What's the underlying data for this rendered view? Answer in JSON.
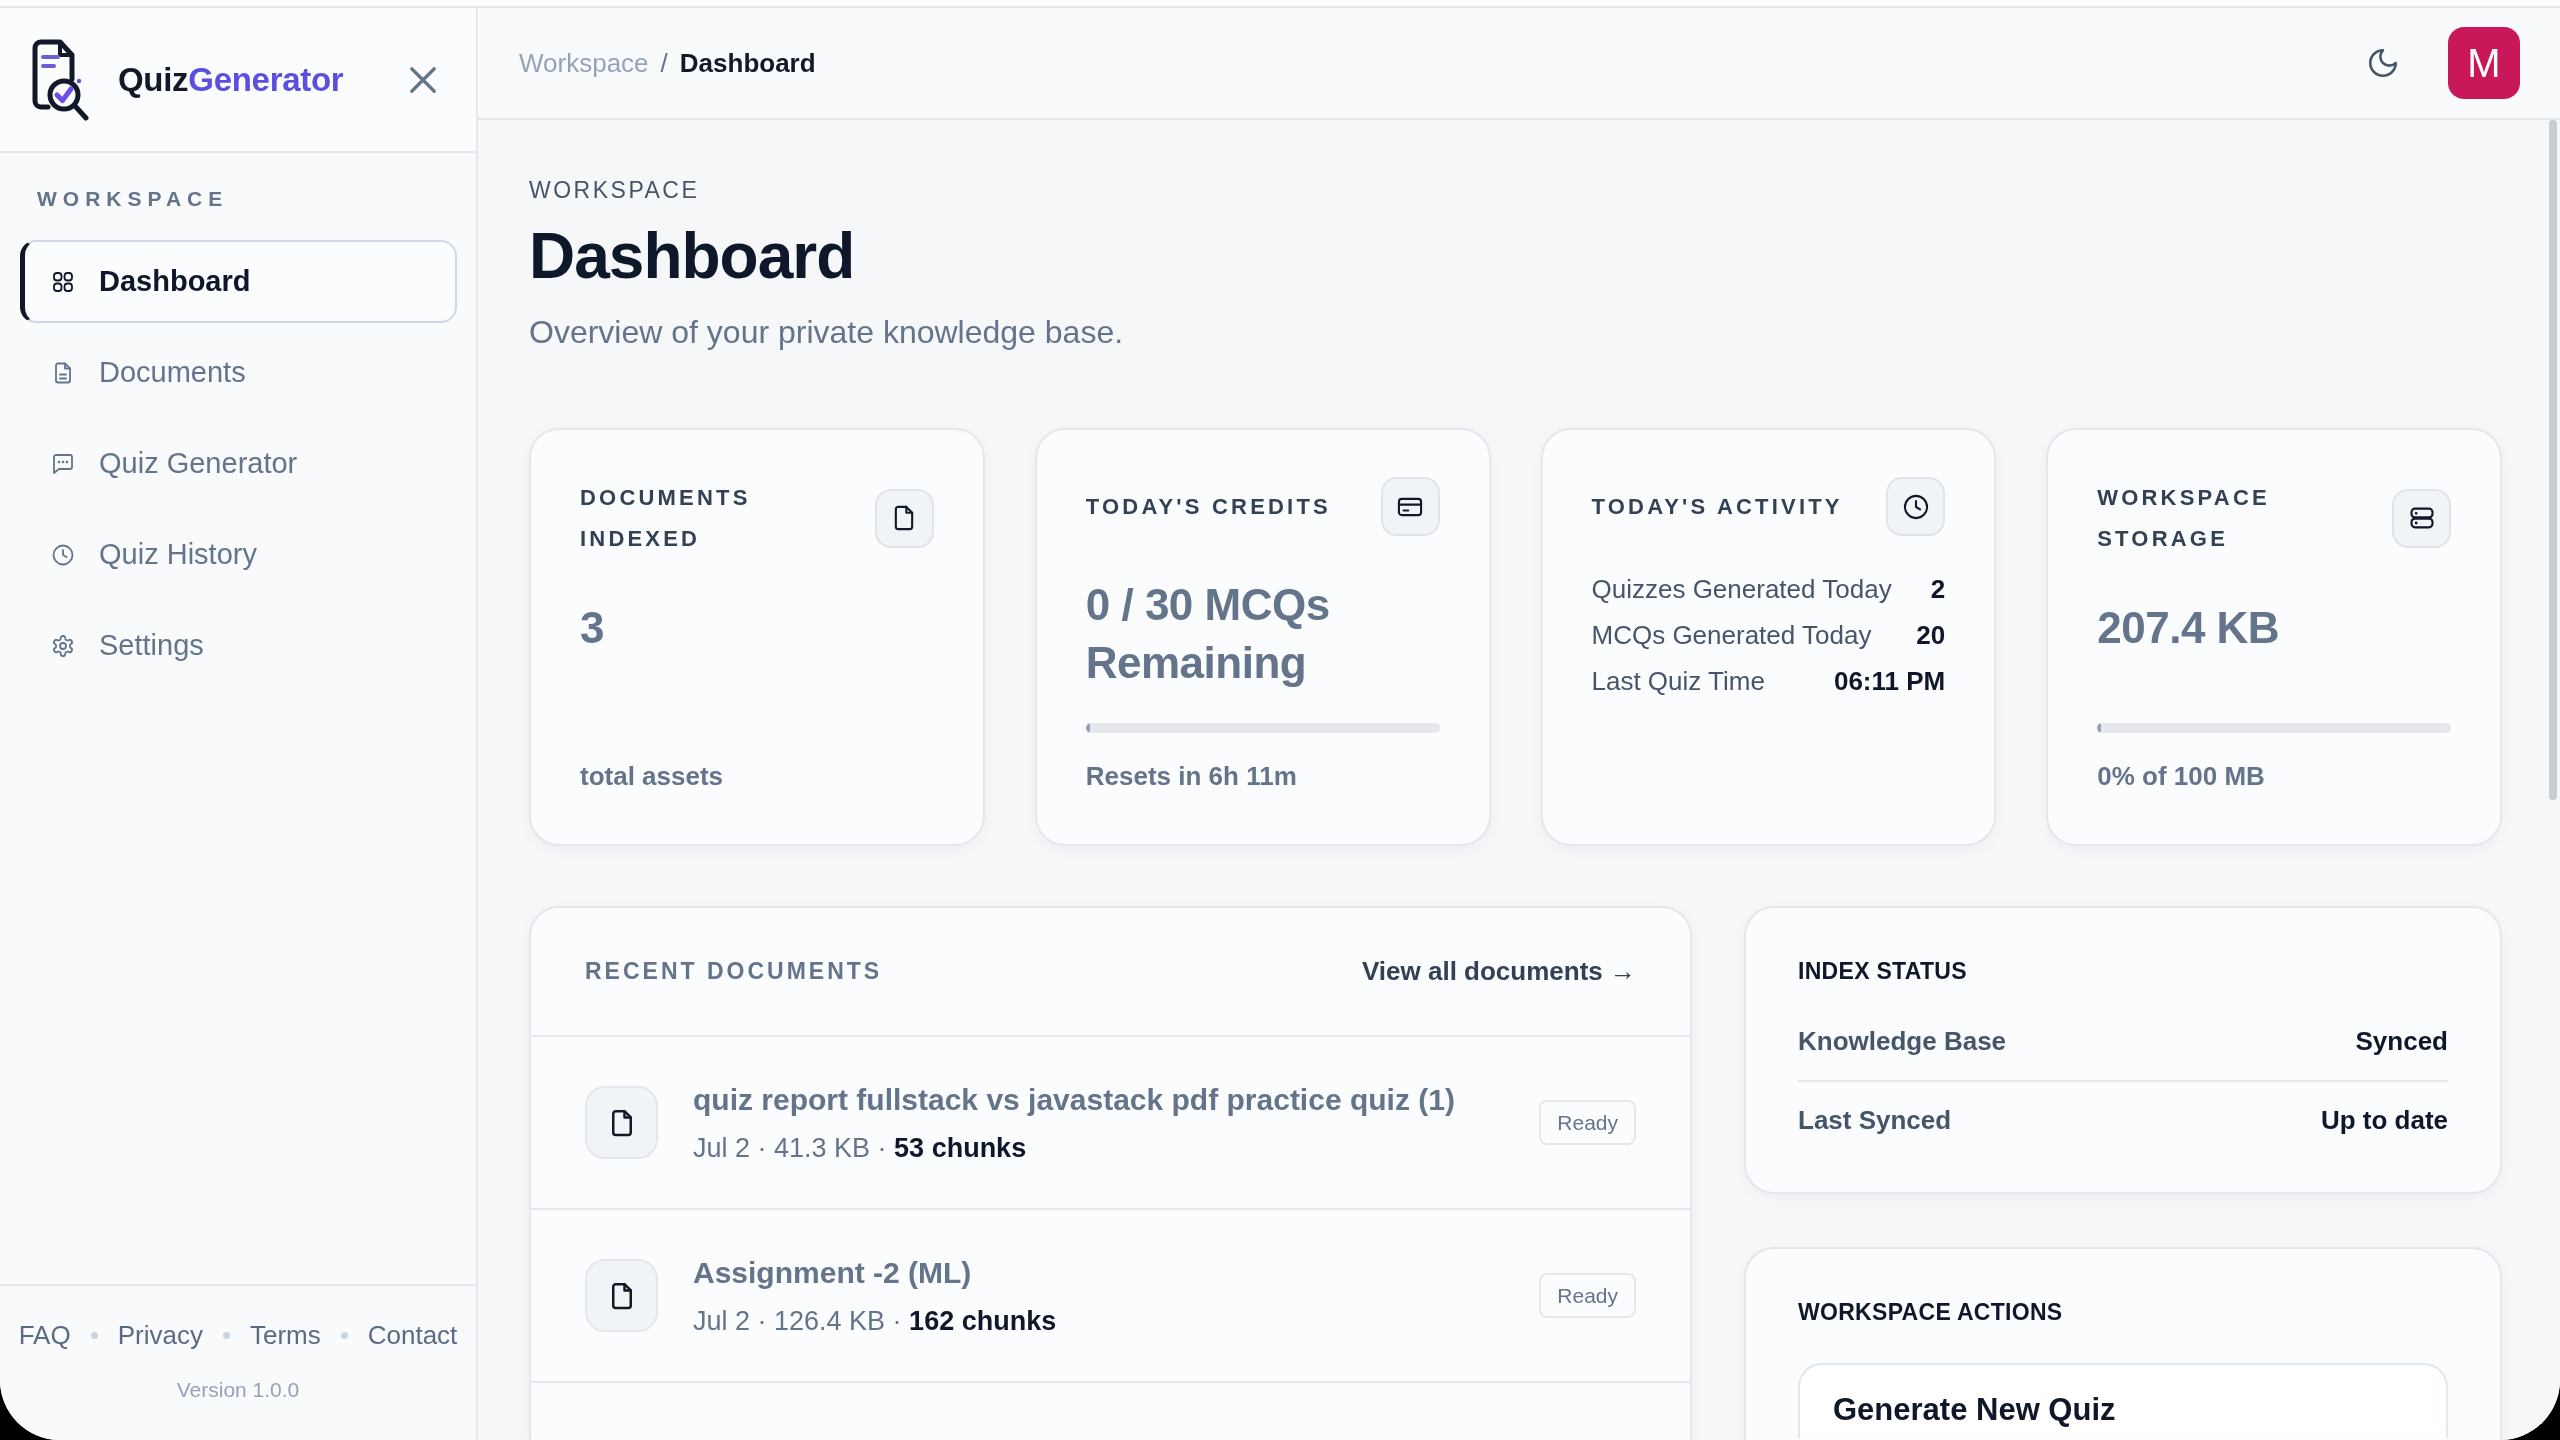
{
  "sidebar": {
    "logo": {
      "name": "Quiz",
      "accent": "Generator"
    },
    "section_label": "WORKSPACE",
    "items": [
      {
        "label": "Dashboard",
        "selected": true
      },
      {
        "label": "Documents",
        "selected": false
      },
      {
        "label": "Quiz Generator",
        "selected": false
      },
      {
        "label": "Quiz History",
        "selected": false
      },
      {
        "label": "Settings",
        "selected": false
      }
    ],
    "footer_links": [
      "FAQ",
      "Privacy",
      "Terms",
      "Contact"
    ],
    "version": "Version 1.0.0"
  },
  "header": {
    "breadcrumb": [
      {
        "label": "Workspace",
        "current": false
      },
      {
        "label": "Dashboard",
        "current": true
      }
    ],
    "separator": "/",
    "avatar": "M"
  },
  "page": {
    "eyebrow": "WORKSPACE",
    "title": "Dashboard",
    "subtitle": "Overview of your private knowledge base."
  },
  "stats": [
    {
      "kind": "value",
      "label": "DOCUMENTS INDEXED",
      "value": "3",
      "footer": "total assets"
    },
    {
      "kind": "progress",
      "label": "TODAY'S CREDITS",
      "value": "0 / 30 MCQs Remaining",
      "level": 0,
      "footer": "Resets in 6h 11m"
    },
    {
      "kind": "list",
      "label": "TODAY'S ACTIVITY",
      "rows": [
        {
          "label": "Quizzes Generated Today",
          "value": "2"
        },
        {
          "label": "MCQs Generated Today",
          "value": "20"
        },
        {
          "label": "Last Quiz Time",
          "value": "06:11 PM"
        }
      ]
    },
    {
      "kind": "progress",
      "label": "WORKSPACE STORAGE",
      "value": "207.4 KB",
      "level": 0,
      "footer": "0% of 100 MB"
    }
  ],
  "recent_documents": {
    "title": "RECENT DOCUMENTS",
    "link": "View all documents →",
    "items": [
      {
        "title": "quiz report fullstack vs javastack pdf practice quiz (1)",
        "meta": "Jul 2 · 41.3 KB · **53 chunks**",
        "status": "Ready"
      },
      {
        "title": "Assignment -2 (ML)",
        "meta": "Jul 2 · 126.4 KB · **162 chunks**",
        "status": "Ready"
      }
    ]
  },
  "index_status": {
    "title": "INDEX STATUS",
    "rows": [
      {
        "label": "Knowledge Base",
        "value": "Synced"
      },
      {
        "label": "Last Synced",
        "value": "Up to date"
      }
    ]
  },
  "workspace_actions": {
    "title": "WORKSPACE ACTIONS",
    "buttons": [
      "Generate New Quiz"
    ]
  }
}
